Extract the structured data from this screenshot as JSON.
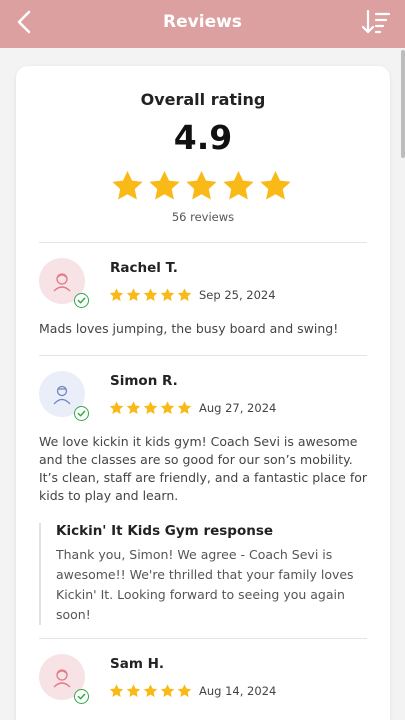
{
  "header": {
    "title": "Reviews",
    "back_icon": "chevron-left-icon",
    "sort_icon": "sort-descending-icon",
    "color": "#dca0a0"
  },
  "overall": {
    "label": "Overall rating",
    "score": "4.9",
    "stars": 5,
    "count": "56 reviews",
    "star_color": "#f9b916"
  },
  "reviews": [
    {
      "name": "Rachel T.",
      "rating": 5,
      "date": "Sep 25, 2024",
      "text": "Mads loves jumping, the busy board and swing!",
      "avatar_icon": "user-female-icon"
    },
    {
      "name": "Simon R.",
      "rating": 5,
      "date": "Aug 27, 2024",
      "text": "We love kickin it kids gym! Coach Sevi is awesome and the classes are so good for our son’s mobility. It’s clean, staff are friendly, and a fantastic place for kids to play and learn.",
      "avatar_icon": "user-male-icon",
      "response": {
        "title": "Kickin' It Kids Gym response",
        "text": "Thank you, Simon! We agree - Coach Sevi is awesome!! We're thrilled that your family loves Kickin' It. Looking forward to seeing you again soon!"
      }
    },
    {
      "name": "Sam H.",
      "rating": 5,
      "date": "Aug 14, 2024",
      "avatar_icon": "user-female-icon"
    }
  ]
}
